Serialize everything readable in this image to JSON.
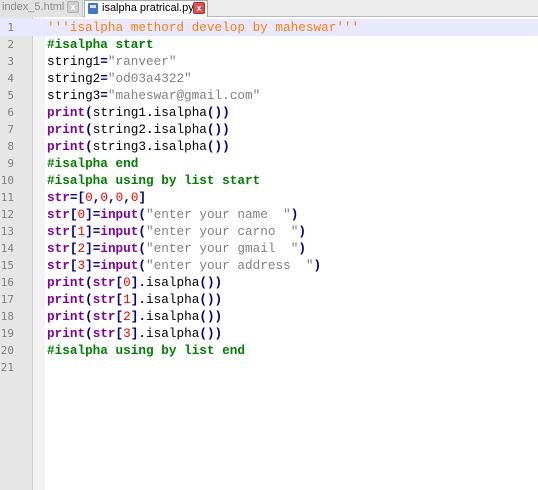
{
  "tabs": [
    {
      "label": "index_5.html",
      "close": "x",
      "active": false
    },
    {
      "label": "isalpha pratrical.py",
      "close": "x",
      "active": true
    }
  ],
  "colors": {
    "comment": "#008000",
    "string": "#808080",
    "docstring": "#ff8000",
    "keyword": "#8000a0",
    "operator": "#000080",
    "number": "#ff0000",
    "active_line": "#e8e8ff"
  },
  "lines": [
    {
      "n": "1",
      "tokens": [
        {
          "t": "ds",
          "v": "'''isalpha methord develop by maheswar'''"
        }
      ]
    },
    {
      "n": "2",
      "tokens": [
        {
          "t": "cm",
          "v": "#isalpha start"
        }
      ]
    },
    {
      "n": "3",
      "tokens": [
        {
          "t": "pl",
          "v": "string1"
        },
        {
          "t": "op",
          "v": "="
        },
        {
          "t": "str",
          "v": "\"ranveer\""
        }
      ]
    },
    {
      "n": "4",
      "tokens": [
        {
          "t": "pl",
          "v": "string2"
        },
        {
          "t": "op",
          "v": "="
        },
        {
          "t": "str",
          "v": "\"od03a4322\""
        }
      ]
    },
    {
      "n": "5",
      "tokens": [
        {
          "t": "pl",
          "v": "string3"
        },
        {
          "t": "op",
          "v": "="
        },
        {
          "t": "str",
          "v": "\"maheswar@gmail.com\""
        }
      ]
    },
    {
      "n": "6",
      "tokens": [
        {
          "t": "kw",
          "v": "print"
        },
        {
          "t": "op",
          "v": "("
        },
        {
          "t": "pl",
          "v": "string1"
        },
        {
          "t": "op",
          "v": "."
        },
        {
          "t": "pl",
          "v": "isalpha"
        },
        {
          "t": "op",
          "v": "())"
        }
      ]
    },
    {
      "n": "7",
      "tokens": [
        {
          "t": "kw",
          "v": "print"
        },
        {
          "t": "op",
          "v": "("
        },
        {
          "t": "pl",
          "v": "string2"
        },
        {
          "t": "op",
          "v": "."
        },
        {
          "t": "pl",
          "v": "isalpha"
        },
        {
          "t": "op",
          "v": "())"
        }
      ]
    },
    {
      "n": "8",
      "tokens": [
        {
          "t": "kw",
          "v": "print"
        },
        {
          "t": "op",
          "v": "("
        },
        {
          "t": "pl",
          "v": "string3"
        },
        {
          "t": "op",
          "v": "."
        },
        {
          "t": "pl",
          "v": "isalpha"
        },
        {
          "t": "op",
          "v": "())"
        }
      ]
    },
    {
      "n": "9",
      "tokens": [
        {
          "t": "cm",
          "v": "#isalpha end"
        }
      ]
    },
    {
      "n": "10",
      "tokens": [
        {
          "t": "cm",
          "v": "#isalpha using by list start"
        }
      ]
    },
    {
      "n": "11",
      "tokens": [
        {
          "t": "kw",
          "v": "str"
        },
        {
          "t": "op",
          "v": "=["
        },
        {
          "t": "nm",
          "v": "0"
        },
        {
          "t": "op",
          "v": ","
        },
        {
          "t": "nm",
          "v": "0"
        },
        {
          "t": "op",
          "v": ","
        },
        {
          "t": "nm",
          "v": "0"
        },
        {
          "t": "op",
          "v": ","
        },
        {
          "t": "nm",
          "v": "0"
        },
        {
          "t": "op",
          "v": "]"
        }
      ]
    },
    {
      "n": "12",
      "tokens": [
        {
          "t": "kw",
          "v": "str"
        },
        {
          "t": "op",
          "v": "["
        },
        {
          "t": "nm",
          "v": "0"
        },
        {
          "t": "op",
          "v": "]="
        },
        {
          "t": "kw",
          "v": "input"
        },
        {
          "t": "op",
          "v": "("
        },
        {
          "t": "str",
          "v": "\"enter your name  \""
        },
        {
          "t": "op",
          "v": ")"
        }
      ]
    },
    {
      "n": "13",
      "tokens": [
        {
          "t": "kw",
          "v": "str"
        },
        {
          "t": "op",
          "v": "["
        },
        {
          "t": "nm",
          "v": "1"
        },
        {
          "t": "op",
          "v": "]="
        },
        {
          "t": "kw",
          "v": "input"
        },
        {
          "t": "op",
          "v": "("
        },
        {
          "t": "str",
          "v": "\"enter your carno  \""
        },
        {
          "t": "op",
          "v": ")"
        }
      ]
    },
    {
      "n": "14",
      "tokens": [
        {
          "t": "kw",
          "v": "str"
        },
        {
          "t": "op",
          "v": "["
        },
        {
          "t": "nm",
          "v": "2"
        },
        {
          "t": "op",
          "v": "]="
        },
        {
          "t": "kw",
          "v": "input"
        },
        {
          "t": "op",
          "v": "("
        },
        {
          "t": "str",
          "v": "\"enter your gmail  \""
        },
        {
          "t": "op",
          "v": ")"
        }
      ]
    },
    {
      "n": "15",
      "tokens": [
        {
          "t": "kw",
          "v": "str"
        },
        {
          "t": "op",
          "v": "["
        },
        {
          "t": "nm",
          "v": "3"
        },
        {
          "t": "op",
          "v": "]="
        },
        {
          "t": "kw",
          "v": "input"
        },
        {
          "t": "op",
          "v": "("
        },
        {
          "t": "str",
          "v": "\"enter your address  \""
        },
        {
          "t": "op",
          "v": ")"
        }
      ]
    },
    {
      "n": "16",
      "tokens": [
        {
          "t": "kw",
          "v": "print"
        },
        {
          "t": "op",
          "v": "("
        },
        {
          "t": "kw",
          "v": "str"
        },
        {
          "t": "op",
          "v": "["
        },
        {
          "t": "nm",
          "v": "0"
        },
        {
          "t": "op",
          "v": "]."
        },
        {
          "t": "pl",
          "v": "isalpha"
        },
        {
          "t": "op",
          "v": "())"
        }
      ]
    },
    {
      "n": "17",
      "tokens": [
        {
          "t": "kw",
          "v": "print"
        },
        {
          "t": "op",
          "v": "("
        },
        {
          "t": "kw",
          "v": "str"
        },
        {
          "t": "op",
          "v": "["
        },
        {
          "t": "nm",
          "v": "1"
        },
        {
          "t": "op",
          "v": "]."
        },
        {
          "t": "pl",
          "v": "isalpha"
        },
        {
          "t": "op",
          "v": "())"
        }
      ]
    },
    {
      "n": "18",
      "tokens": [
        {
          "t": "kw",
          "v": "print"
        },
        {
          "t": "op",
          "v": "("
        },
        {
          "t": "kw",
          "v": "str"
        },
        {
          "t": "op",
          "v": "["
        },
        {
          "t": "nm",
          "v": "2"
        },
        {
          "t": "op",
          "v": "]."
        },
        {
          "t": "pl",
          "v": "isalpha"
        },
        {
          "t": "op",
          "v": "())"
        }
      ]
    },
    {
      "n": "19",
      "tokens": [
        {
          "t": "kw",
          "v": "print"
        },
        {
          "t": "op",
          "v": "("
        },
        {
          "t": "kw",
          "v": "str"
        },
        {
          "t": "op",
          "v": "["
        },
        {
          "t": "nm",
          "v": "3"
        },
        {
          "t": "op",
          "v": "]."
        },
        {
          "t": "pl",
          "v": "isalpha"
        },
        {
          "t": "op",
          "v": "())"
        }
      ]
    },
    {
      "n": "20",
      "tokens": [
        {
          "t": "cm",
          "v": "#isalpha using by list end"
        }
      ]
    },
    {
      "n": "21",
      "tokens": []
    }
  ]
}
